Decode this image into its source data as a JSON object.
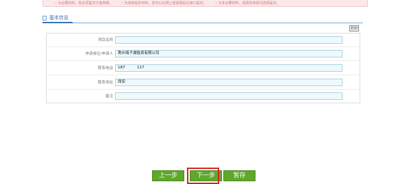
{
  "notice": {
    "items": [
      "为必要材料，您必须提交才能申报。",
      "为容缺后补材料，您可以在网上受受理后在窗口提交。",
      "为非必要材料，视视实际情况选择提交。"
    ]
  },
  "section": {
    "title": "基本信息"
  },
  "toolbar": {
    "print_label": "打印"
  },
  "form": {
    "fields": [
      {
        "label": "项目名称",
        "value": ""
      },
      {
        "label": "申请单位/申请人",
        "value": "荆州海子湖投资有限公司"
      },
      {
        "label": "联系电话",
        "value": "187          117"
      },
      {
        "label": "联系地址",
        "value": "西安"
      },
      {
        "label": "备注",
        "value": ""
      }
    ]
  },
  "buttons": {
    "prev": "上一步",
    "next": "下一步",
    "save": "暂存"
  },
  "colors": {
    "button_green": "#5fa82a",
    "highlight_red": "#d62020",
    "field_bg": "#eef9fc"
  }
}
